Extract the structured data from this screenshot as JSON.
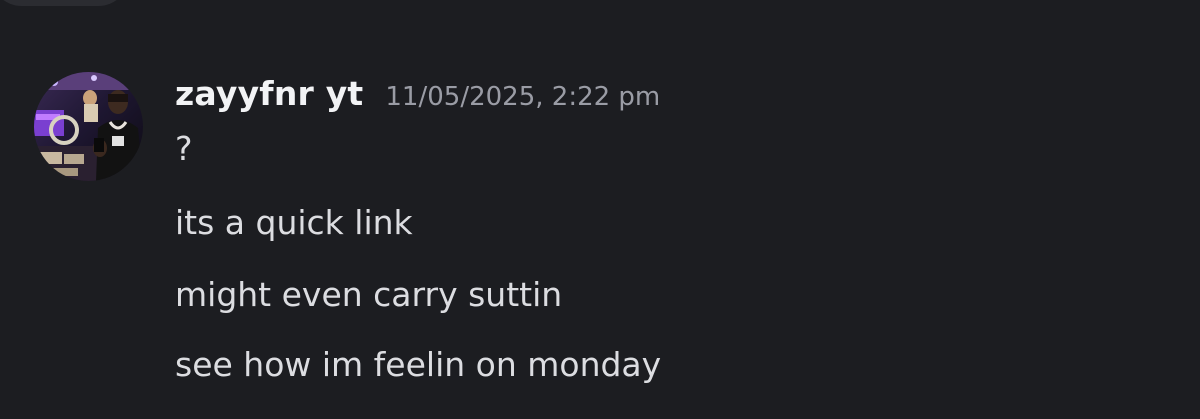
{
  "message": {
    "author": "zayyfnr yt",
    "timestamp": "11/05/2025, 2:22 pm",
    "lines": [
      "?",
      "its a quick link",
      "might even carry suttin",
      "see how im feelin on monday"
    ]
  },
  "avatar": {
    "icon": "user-photo-avatar"
  },
  "colors": {
    "background": "#1c1d21",
    "username": "#f2f3f5",
    "timestamp": "#9a9ca5",
    "message_text": "#dcdde1"
  }
}
